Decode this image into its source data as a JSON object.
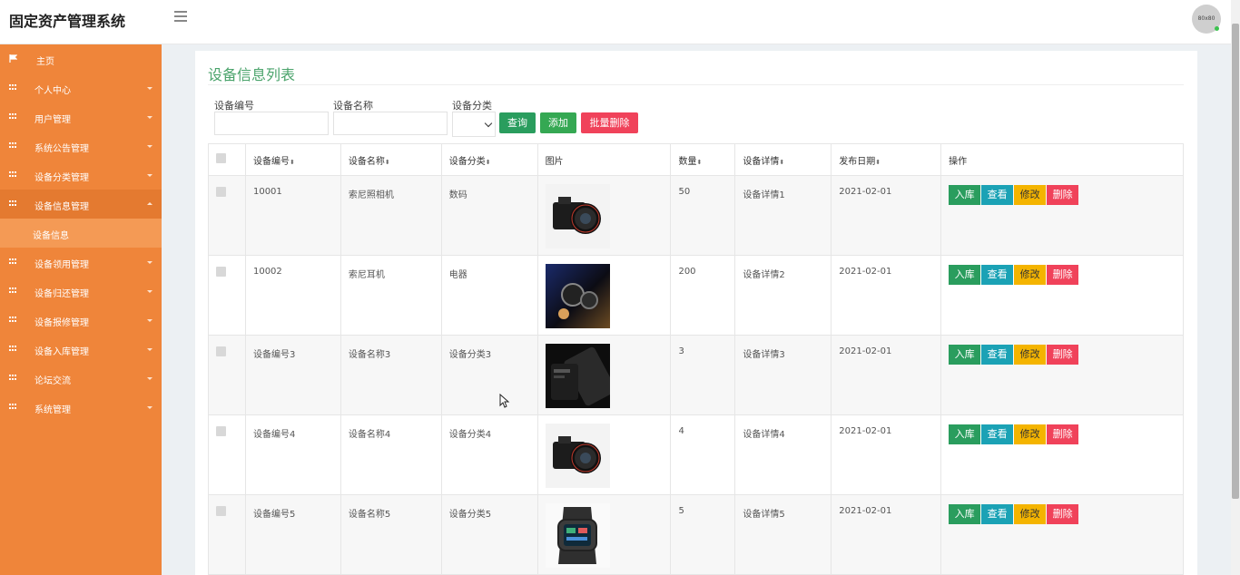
{
  "header": {
    "title": "固定资产管理系统",
    "avatar_text": "80x80"
  },
  "sidebar": {
    "items": [
      {
        "label": "主页",
        "icon": "flag-icon"
      },
      {
        "label": "个人中心",
        "icon": "grid-icon"
      },
      {
        "label": "用户管理",
        "icon": "grid-icon"
      },
      {
        "label": "系统公告管理",
        "icon": "grid-icon"
      },
      {
        "label": "设备分类管理",
        "icon": "grid-icon"
      },
      {
        "label": "设备信息管理",
        "icon": "grid-icon",
        "open": true,
        "sub": "设备信息"
      },
      {
        "label": "设备领用管理",
        "icon": "grid-icon"
      },
      {
        "label": "设备归还管理",
        "icon": "grid-icon"
      },
      {
        "label": "设备报修管理",
        "icon": "grid-icon"
      },
      {
        "label": "设备入库管理",
        "icon": "grid-icon"
      },
      {
        "label": "论坛交流",
        "icon": "grid-icon"
      },
      {
        "label": "系统管理",
        "icon": "grid-icon"
      }
    ]
  },
  "main": {
    "title": "设备信息列表",
    "filters": {
      "code_label": "设备编号",
      "code_value": "",
      "name_label": "设备名称",
      "name_value": "",
      "category_label": "设备分类",
      "category_value": ""
    },
    "buttons": {
      "search": "查询",
      "add": "添加",
      "batch_delete": "批量删除"
    },
    "table": {
      "headers": [
        "设备编号",
        "设备名称",
        "设备分类",
        "图片",
        "数量",
        "设备详情",
        "发布日期",
        "操作"
      ],
      "sort_icon": "⬍",
      "rows": [
        {
          "code": "10001",
          "name": "索尼照相机",
          "category": "数码",
          "image": "camera",
          "qty": "50",
          "detail": "设备详情1",
          "date": "2021-02-01"
        },
        {
          "code": "10002",
          "name": "索尼耳机",
          "category": "电器",
          "image": "earphone",
          "qty": "200",
          "detail": "设备详情2",
          "date": "2021-02-01"
        },
        {
          "code": "设备编号3",
          "name": "设备名称3",
          "category": "设备分类3",
          "image": "dark-device",
          "qty": "3",
          "detail": "设备详情3",
          "date": "2021-02-01"
        },
        {
          "code": "设备编号4",
          "name": "设备名称4",
          "category": "设备分类4",
          "image": "camera",
          "qty": "4",
          "detail": "设备详情4",
          "date": "2021-02-01"
        },
        {
          "code": "设备编号5",
          "name": "设备名称5",
          "category": "设备分类5",
          "image": "smartwatch",
          "qty": "5",
          "detail": "设备详情5",
          "date": "2021-02-01"
        }
      ],
      "row_actions": {
        "in": "入库",
        "view": "查看",
        "edit": "修改",
        "del": "删除"
      }
    }
  },
  "colors": {
    "sidebar": "#ef853a",
    "title": "#4aa36b",
    "btn_green": "#2a9d5e",
    "btn_cyan": "#1ba2b5",
    "btn_yellow": "#f4b400",
    "btn_red": "#f0425a"
  }
}
